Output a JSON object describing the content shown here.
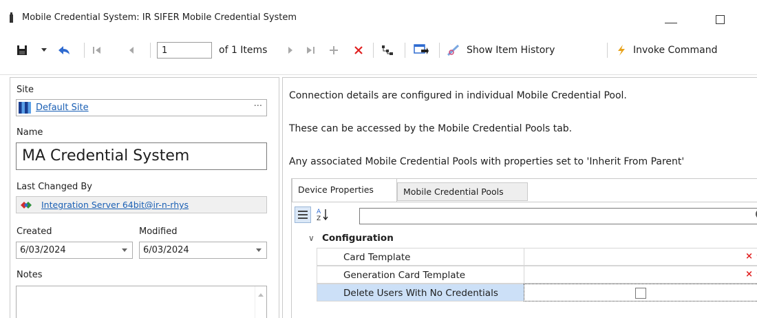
{
  "window": {
    "title": "Mobile Credential System: IR SIFER Mobile Credential System"
  },
  "toolbar": {
    "page_value": "1",
    "of_items": "of 1 Items",
    "show_item_history": "Show Item History",
    "invoke_command": "Invoke Command"
  },
  "form": {
    "site_label": "Site",
    "site_value": "Default Site",
    "name_label": "Name",
    "name_value": "MA Credential System",
    "last_changed_label": "Last Changed By",
    "last_changed_value": "Integration Server 64bit@ir-n-rhys",
    "created_label": "Created",
    "created_value": "6/03/2024",
    "modified_label": "Modified",
    "modified_value": "6/03/2024",
    "notes_label": "Notes",
    "ellipsis": "···"
  },
  "info": {
    "line1": "Connection details are configured in individual Mobile Credential Pool.",
    "line2": "These can be accessed by the Mobile Credential Pools tab.",
    "line3": "Any associated Mobile Credential Pools with properties set to 'Inherit From Parent'"
  },
  "tabs": [
    {
      "label": "Device Properties",
      "active": true
    },
    {
      "label": "Mobile Credential Pools",
      "active": false
    }
  ],
  "property_grid": {
    "category": "Configuration",
    "rows": [
      {
        "name": "Card Template",
        "clear": "×",
        "dots": "···"
      },
      {
        "name": "Generation Card Template",
        "clear": "×",
        "dots": "···"
      },
      {
        "name": "Delete Users With No Credentials",
        "checked": false
      }
    ]
  },
  "colors": {
    "link": "#1a5fb4",
    "clear": "#e02020",
    "selected_row": "#cce0f7"
  }
}
